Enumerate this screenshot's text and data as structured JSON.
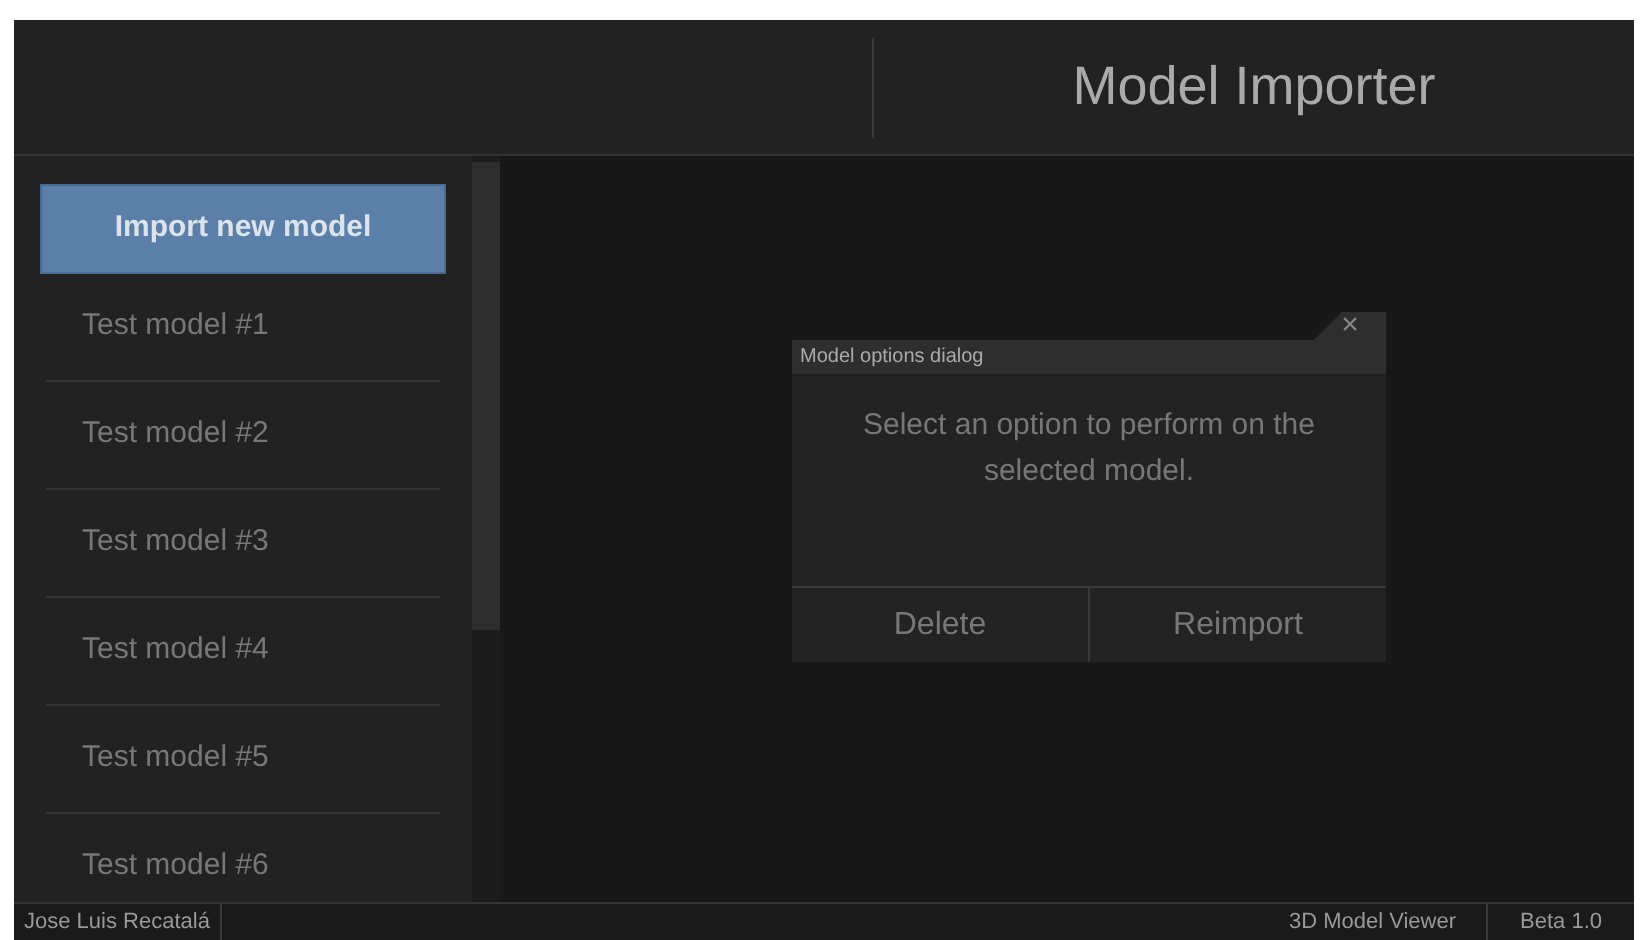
{
  "header": {
    "title": "Model Importer"
  },
  "sidebar": {
    "import_button": "Import new model",
    "items": [
      {
        "label": "Test model #1"
      },
      {
        "label": "Test model #2"
      },
      {
        "label": "Test model #3"
      },
      {
        "label": "Test model #4"
      },
      {
        "label": "Test model #5"
      },
      {
        "label": "Test model #6"
      }
    ]
  },
  "dialog": {
    "title": "Model options dialog",
    "close": "×",
    "message": "Select an option to perform on the selected model.",
    "buttons": [
      "Delete",
      "Reimport"
    ]
  },
  "status_bar": {
    "author": "Jose Luis Recatalá",
    "app": "3D Model Viewer",
    "version": "Beta 1.0"
  }
}
